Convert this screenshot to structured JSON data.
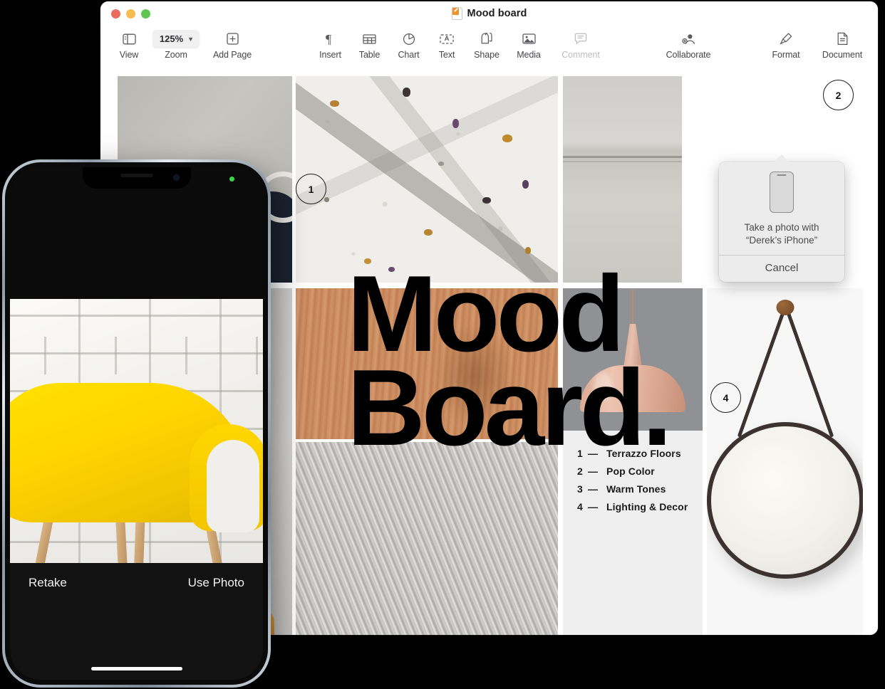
{
  "window": {
    "title": "Mood board",
    "traffic_lights": [
      "close",
      "minimize",
      "zoom"
    ],
    "doc_icon": "pages-document-icon"
  },
  "toolbar": {
    "left_group": [
      {
        "label": "View",
        "icon": "sidebar-icon",
        "enabled": true
      },
      {
        "label": "Zoom",
        "icon": "zoom-popup",
        "value": "125%",
        "enabled": true
      },
      {
        "label": "Add Page",
        "icon": "plus-square-icon",
        "enabled": true
      }
    ],
    "center_group": [
      {
        "label": "Insert",
        "icon": "pilcrow-icon",
        "enabled": true
      },
      {
        "label": "Table",
        "icon": "table-grid-icon",
        "enabled": true
      },
      {
        "label": "Chart",
        "icon": "pie-chart-icon",
        "enabled": true
      },
      {
        "label": "Text",
        "icon": "text-box-icon",
        "enabled": true
      },
      {
        "label": "Shape",
        "icon": "shapes-icon",
        "enabled": true
      },
      {
        "label": "Media",
        "icon": "photo-icon",
        "enabled": true
      },
      {
        "label": "Comment",
        "icon": "comment-bubble-icon",
        "enabled": false
      }
    ],
    "collaborate": {
      "label": "Collaborate",
      "icon": "person-add-icon",
      "enabled": true
    },
    "right_group": [
      {
        "label": "Format",
        "icon": "paintbrush-icon",
        "enabled": true
      },
      {
        "label": "Document",
        "icon": "document-page-icon",
        "enabled": true
      }
    ]
  },
  "document": {
    "headline_line1": "Mood",
    "headline_line2": "Board.",
    "badges": [
      {
        "number": "1"
      },
      {
        "number": "2"
      },
      {
        "number": "4"
      }
    ],
    "legend": [
      {
        "number": "1",
        "dash": "—",
        "label": "Terrazzo Floors"
      },
      {
        "number": "2",
        "dash": "—",
        "label": "Pop Color"
      },
      {
        "number": "3",
        "dash": "—",
        "label": "Warm Tones"
      },
      {
        "number": "4",
        "dash": "—",
        "label": "Lighting & Decor"
      }
    ],
    "images": [
      {
        "name": "grey-wall-chair-photo"
      },
      {
        "name": "terrazzo-slab-photo"
      },
      {
        "name": "concrete-wall-photo"
      },
      {
        "name": "plaster-wall-sofa-photo"
      },
      {
        "name": "wood-grain-photo"
      },
      {
        "name": "grey-fur-rug-photo"
      },
      {
        "name": "pendant-lamp-photo"
      },
      {
        "name": "round-hanging-mirror-photo"
      }
    ]
  },
  "popover": {
    "device_icon": "iphone-glyph",
    "message_line1": "Take a photo with",
    "message_line2": "“Derek’s iPhone”",
    "cancel_label": "Cancel"
  },
  "iphone": {
    "status_indicator": "camera-in-use-green-dot",
    "preview_subject": "yellow-eames-chair-white-brick",
    "retake_label": "Retake",
    "use_photo_label": "Use Photo"
  },
  "colors": {
    "accent_yellow": "#FFD400",
    "close_red": "#ED6A5E",
    "minimize_yellow": "#F5BD4F",
    "zoom_green": "#61C554",
    "camera_green": "#3CD74B"
  }
}
